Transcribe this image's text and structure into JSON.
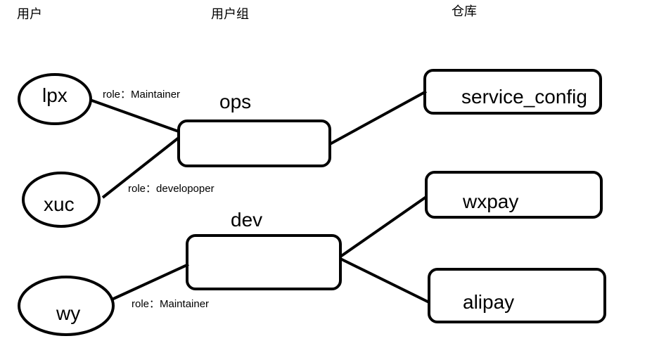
{
  "headers": {
    "users": "用户",
    "groups": "用户组",
    "repos": "仓库"
  },
  "users": [
    "lpx",
    "xuc",
    "wy"
  ],
  "groups": [
    "ops",
    "dev"
  ],
  "repos": [
    "service_config",
    "wxpay",
    "alipay"
  ],
  "roles": {
    "lpx_ops": "role：Maintainer",
    "xuc_ops": "role：developoper",
    "wy_dev": "role：Maintainer"
  },
  "colors": {
    "stroke": "#000000",
    "background": "#ffffff"
  }
}
